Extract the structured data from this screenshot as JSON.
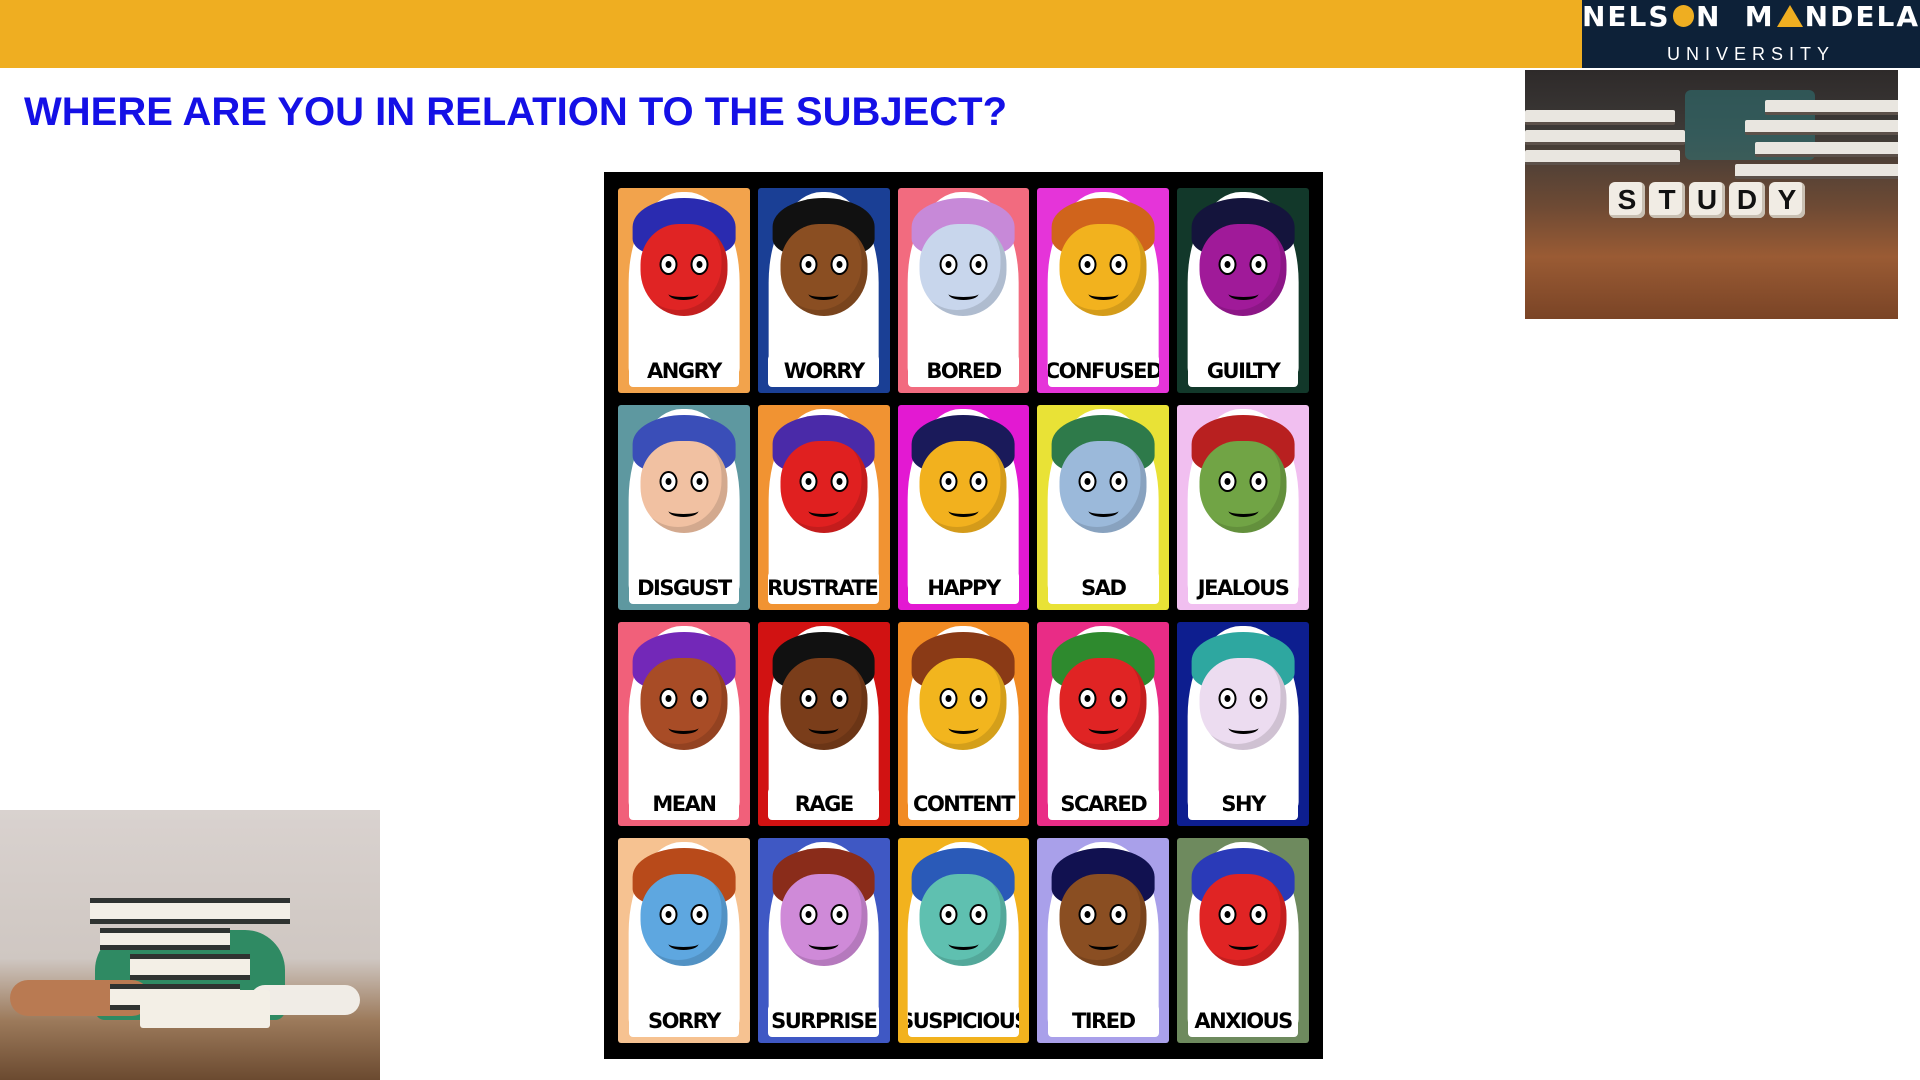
{
  "header": {
    "bar_color": "#efae21",
    "logo": {
      "word1": "NELS",
      "word1_end": "N",
      "word2": "M",
      "word2_end": "NDELA",
      "subtitle": "UNIVERSITY",
      "bg": "#0d2138"
    }
  },
  "slide": {
    "title": "WHERE ARE YOU IN RELATION TO THE SUBJECT?",
    "title_color": "#1410e6"
  },
  "study_image": {
    "letters": [
      "S",
      "T",
      "U",
      "D",
      "Y"
    ]
  },
  "emotions": [
    {
      "label": "ANGRY",
      "bg": "#f2a34c",
      "face": "#e02424",
      "hair": "#2a2bb0"
    },
    {
      "label": "WORRY",
      "bg": "#1a3f95",
      "face": "#8a4e22",
      "hair": "#111111"
    },
    {
      "label": "BORED",
      "bg": "#f26b7f",
      "face": "#c8d6ec",
      "hair": "#c789d8"
    },
    {
      "label": "CONFUSED",
      "bg": "#e534d9",
      "face": "#f2b21e",
      "hair": "#d0641c"
    },
    {
      "label": "GUILTY",
      "bg": "#12382a",
      "face": "#a01a99",
      "hair": "#14143c"
    },
    {
      "label": "DISGUST",
      "bg": "#5e98a0",
      "face": "#f1c1a2",
      "hair": "#3a4eb8"
    },
    {
      "label": "FRUSTRATED",
      "bg": "#f19332",
      "face": "#e02020",
      "hair": "#4a2aa8"
    },
    {
      "label": "HAPPY",
      "bg": "#e319d2",
      "face": "#f2b11e",
      "hair": "#1a1a5a"
    },
    {
      "label": "SAD",
      "bg": "#e9e236",
      "face": "#9bb9da",
      "hair": "#2e7a4a"
    },
    {
      "label": "JEALOUS",
      "bg": "#f1bff0",
      "face": "#71a445",
      "hair": "#b82020"
    },
    {
      "label": "MEAN",
      "bg": "#f1607a",
      "face": "#a84c26",
      "hair": "#7328b8"
    },
    {
      "label": "RAGE",
      "bg": "#d11212",
      "face": "#7a3d1a",
      "hair": "#111111"
    },
    {
      "label": "CONTENT",
      "bg": "#f18b23",
      "face": "#f2b51e",
      "hair": "#8a3a16"
    },
    {
      "label": "SCARED",
      "bg": "#e92c86",
      "face": "#e02424",
      "hair": "#2e8a2e"
    },
    {
      "label": "SHY",
      "bg": "#0d1e8f",
      "face": "#ecdcf0",
      "hair": "#2ea7a0"
    },
    {
      "label": "SORRY",
      "bg": "#f6c291",
      "face": "#5ea7e0",
      "hair": "#b84a1a"
    },
    {
      "label": "SURPRISE",
      "bg": "#3f58c4",
      "face": "#cf8ad8",
      "hair": "#8a2c1a"
    },
    {
      "label": "SUSPICIOUS",
      "bg": "#f2b21e",
      "face": "#5fc0b0",
      "hair": "#2a5ab8"
    },
    {
      "label": "TIRED",
      "bg": "#a9a0ea",
      "face": "#8a4e22",
      "hair": "#111150"
    },
    {
      "label": "ANXIOUS",
      "bg": "#6e8a5e",
      "face": "#e02424",
      "hair": "#2a3ab8"
    }
  ]
}
